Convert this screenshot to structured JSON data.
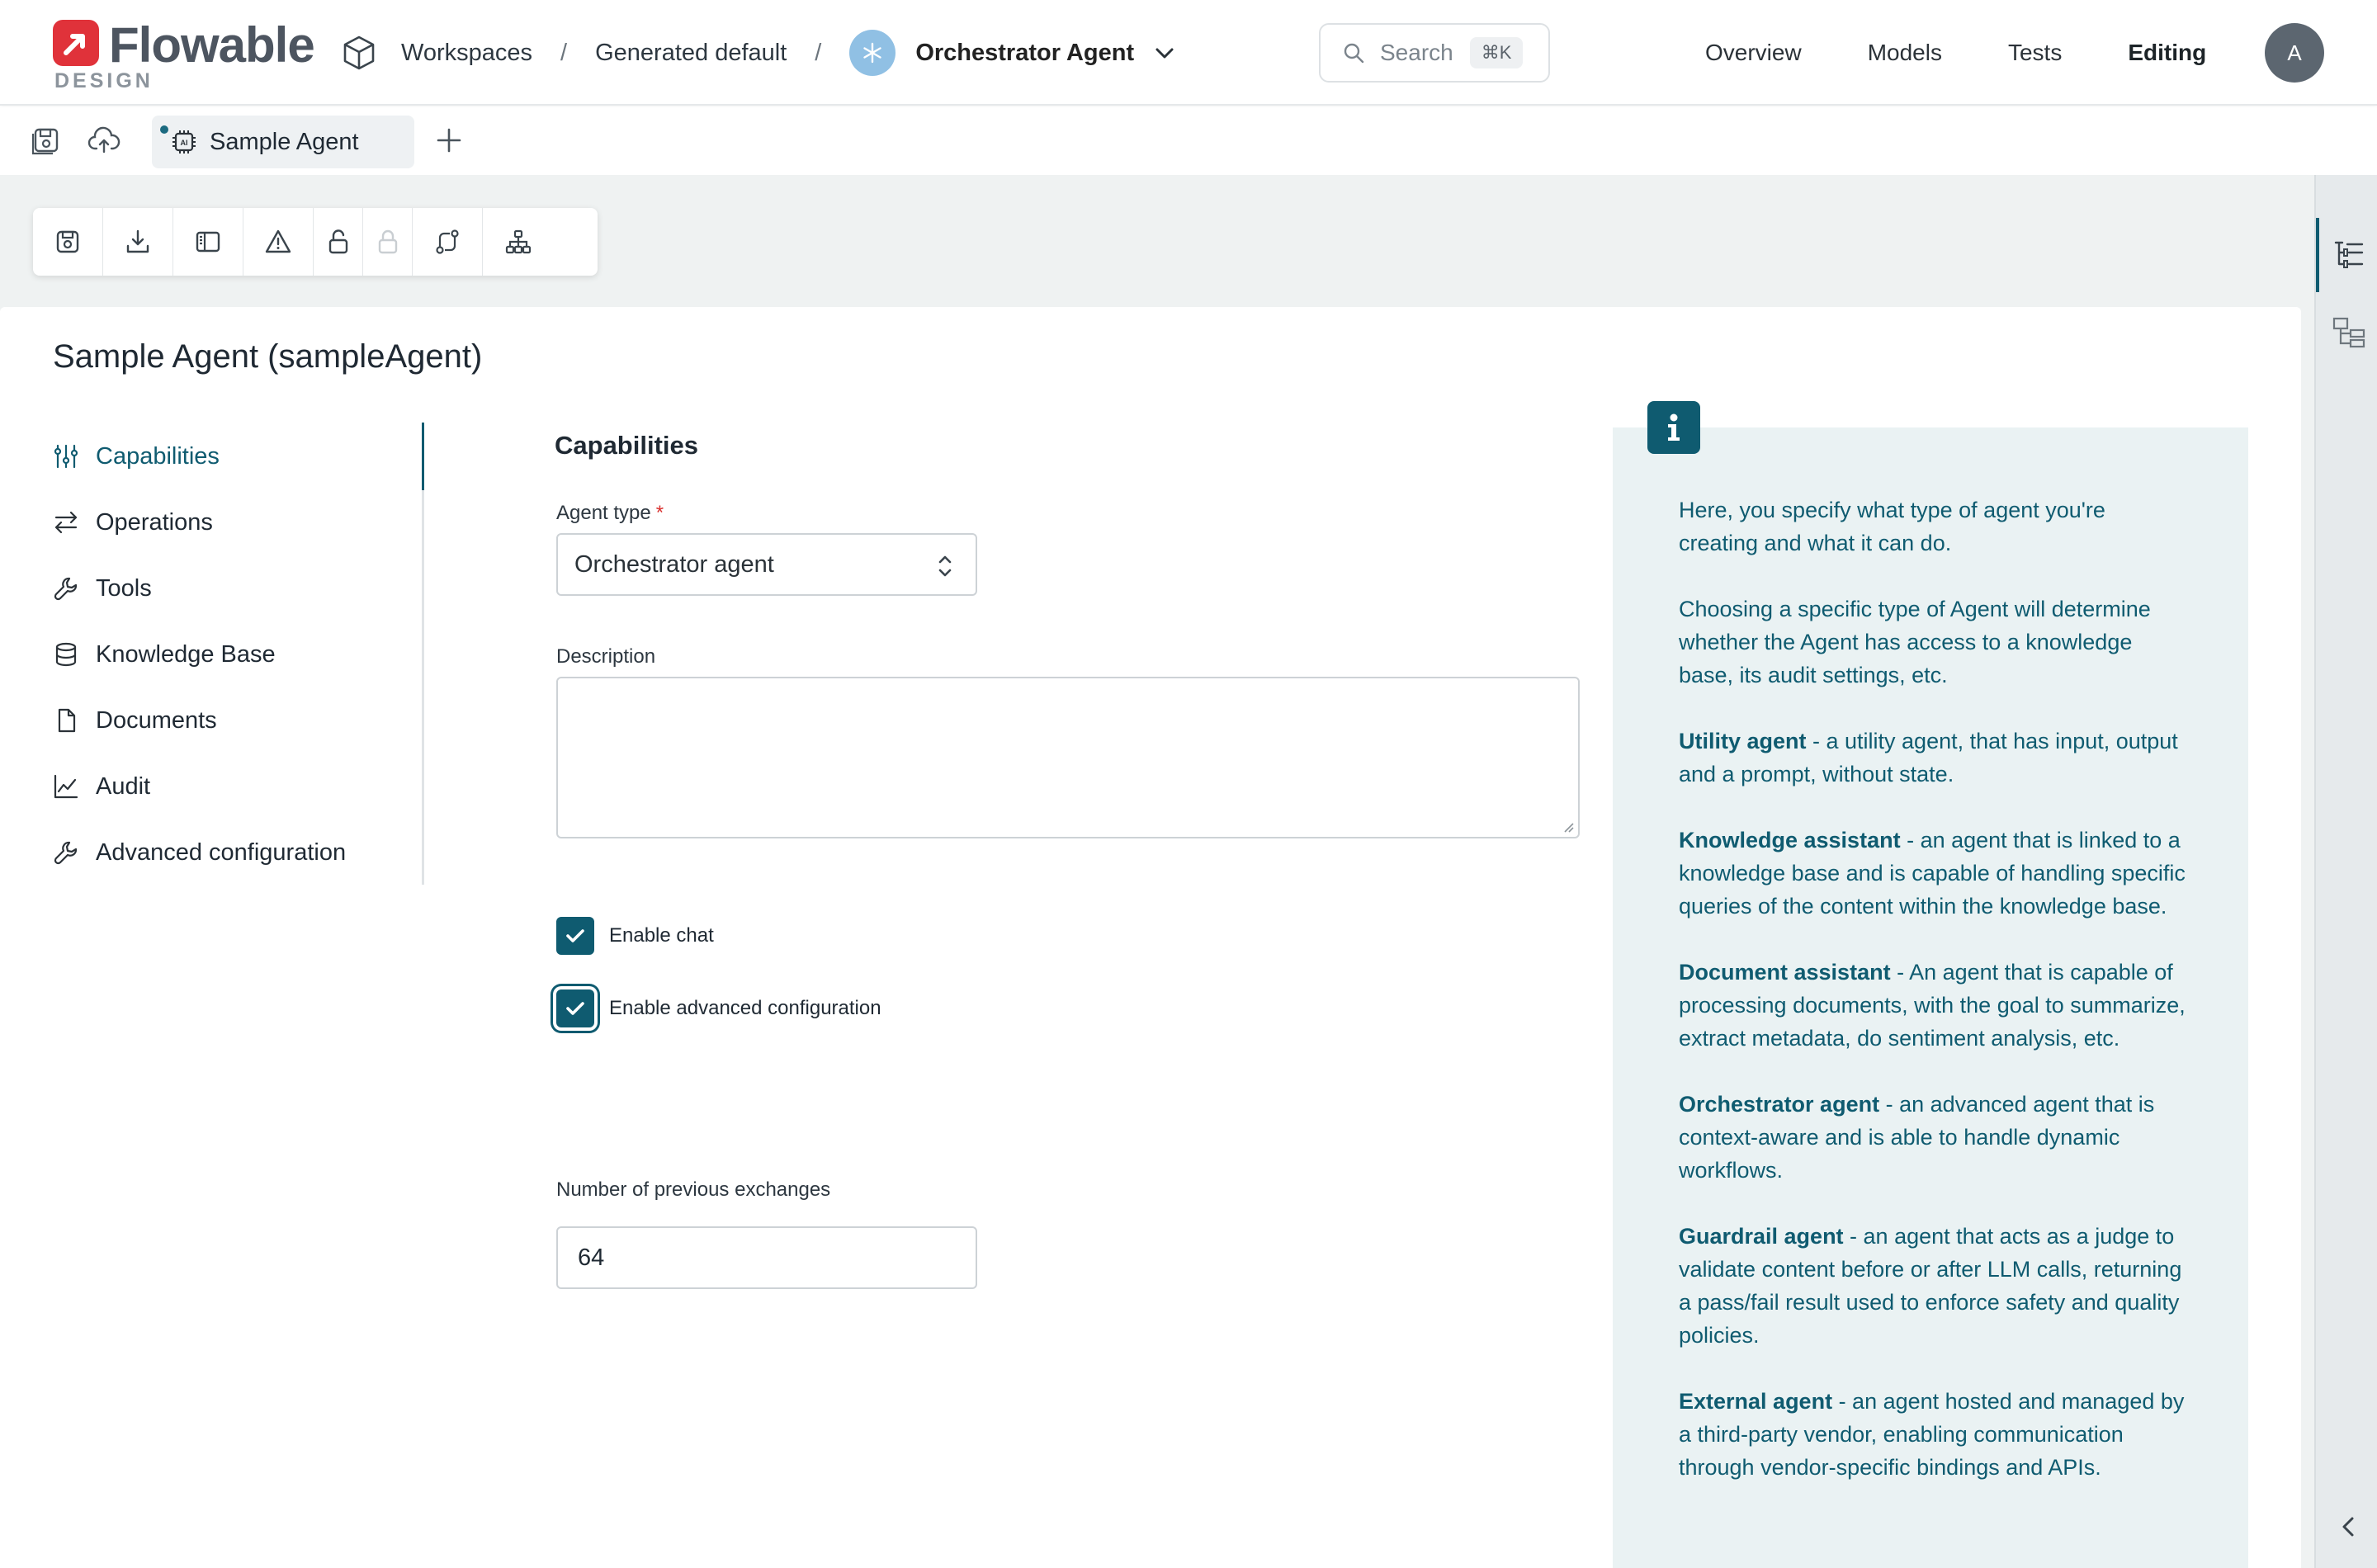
{
  "header": {
    "logo_text": "Flowable",
    "logo_sub": "DESIGN",
    "breadcrumb": {
      "workspaces": "Workspaces",
      "separator": "/",
      "workspace": "Generated default",
      "agent": "Orchestrator Agent"
    },
    "search": {
      "placeholder": "Search",
      "shortcut": "⌘K"
    },
    "nav": [
      "Overview",
      "Models",
      "Tests",
      "Editing"
    ],
    "active_nav": "Editing",
    "avatar_initial": "A"
  },
  "tabs": {
    "open_tab": "Sample Agent",
    "unsaved_indicator": true
  },
  "toolbar": {
    "buttons": [
      "save-icon",
      "download-icon",
      "layout-panel-icon",
      "warning-icon",
      "unlock-icon",
      "lock-icon",
      "compare-icon",
      "hierarchy-icon"
    ]
  },
  "page": {
    "title": "Sample Agent (sampleAgent)"
  },
  "sidebar": {
    "items": [
      {
        "label": "Capabilities",
        "icon": "sliders-icon",
        "active": true
      },
      {
        "label": "Operations",
        "icon": "arrows-exchange-icon",
        "active": false
      },
      {
        "label": "Tools",
        "icon": "wrench-icon",
        "active": false
      },
      {
        "label": "Knowledge Base",
        "icon": "database-icon",
        "active": false
      },
      {
        "label": "Documents",
        "icon": "document-icon",
        "active": false
      },
      {
        "label": "Audit",
        "icon": "line-chart-icon",
        "active": false
      },
      {
        "label": "Advanced configuration",
        "icon": "wrench-icon",
        "active": false
      }
    ]
  },
  "form": {
    "section_title": "Capabilities",
    "agent_type": {
      "label": "Agent type",
      "required_mark": "*",
      "value": "Orchestrator agent"
    },
    "description": {
      "label": "Description",
      "value": ""
    },
    "enable_chat": {
      "label": "Enable chat",
      "checked": true
    },
    "enable_advanced": {
      "label": "Enable advanced configuration",
      "checked": true
    },
    "previous_exchanges": {
      "label": "Number of previous exchanges",
      "value": "64"
    }
  },
  "info": {
    "intro": "Here, you specify what type of agent you're creating and what it can do.",
    "choosing": "Choosing a specific type of Agent will determine whether the Agent has access to a knowledge base, its audit settings, etc.",
    "types": [
      {
        "name": "Utility agent",
        "desc": " - a utility agent, that has input, output and a prompt, without state."
      },
      {
        "name": "Knowledge assistant",
        "desc": " - an agent that is linked to a knowledge base and is capable of handling specific queries of the content within the knowledge base."
      },
      {
        "name": "Document assistant",
        "desc": " - An agent that is capable of processing documents, with the goal to summarize, extract metadata, do sentiment analysis, etc."
      },
      {
        "name": "Orchestrator agent",
        "desc": " - an advanced agent that is context-aware and is able to handle dynamic workflows."
      },
      {
        "name": "Guardrail agent",
        "desc": " - an agent that acts as a judge to validate content before or after LLM calls, returning a pass/fail result used to enforce safety and quality policies."
      },
      {
        "name": "External agent",
        "desc": " - an agent hosted and managed by a third-party vendor, enabling communication through vendor-specific bindings and APIs."
      }
    ]
  },
  "colors": {
    "accent": "#0f5b70",
    "brand_red": "#e0323a",
    "info_bg": "#eaf2f3",
    "canvas_bg": "#eff2f2"
  }
}
